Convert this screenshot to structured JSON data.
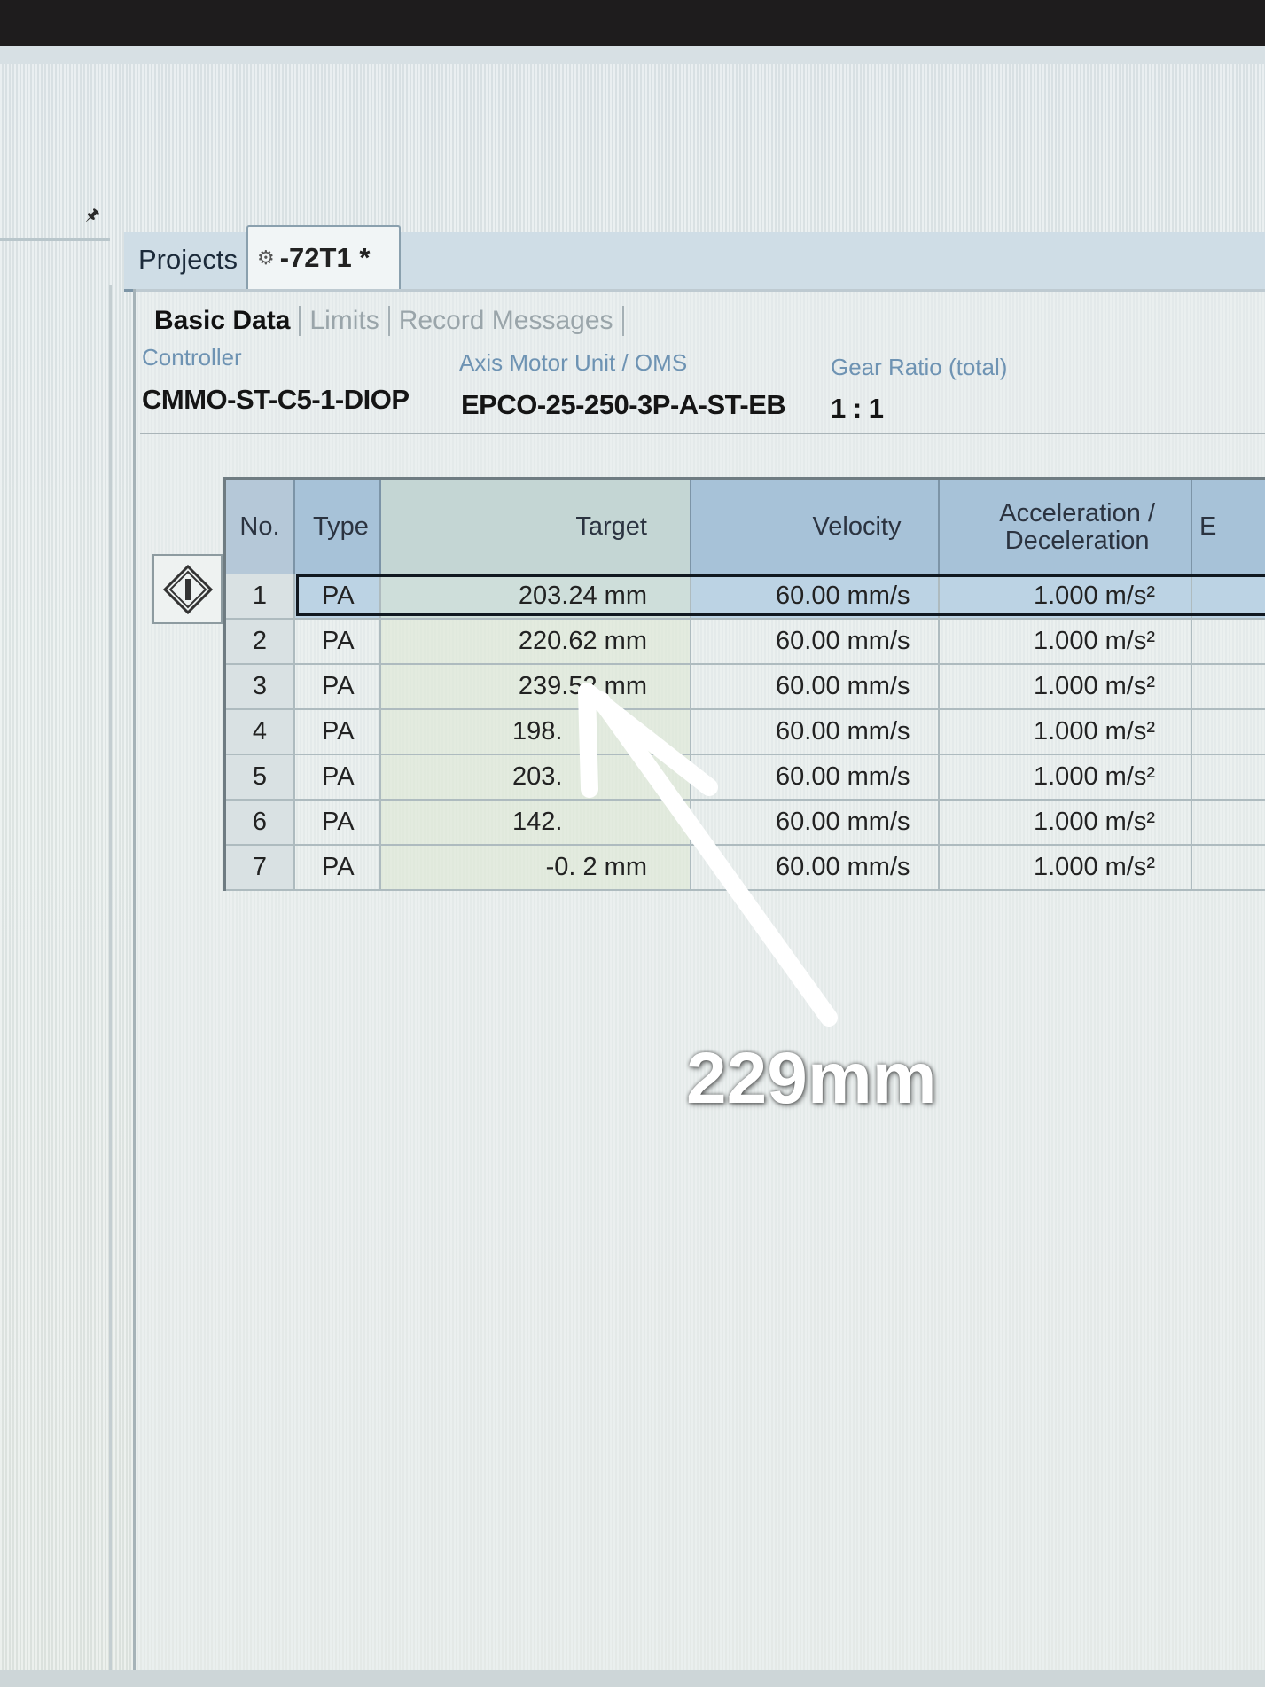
{
  "tabs": {
    "projects_label": "Projects",
    "device_label": "-72T1 *"
  },
  "subtabs": [
    "Basic Data",
    "Limits",
    "Record Messages"
  ],
  "info": {
    "controller_label": "Controller",
    "controller_value": "CMMO-ST-C5-1-DIOP",
    "axis_label": "Axis Motor Unit / OMS",
    "axis_value": "EPCO-25-250-3P-A-ST-EB",
    "gear_label": "Gear Ratio (total)",
    "gear_value": "1 : 1"
  },
  "table": {
    "headers": {
      "no": "No.",
      "type": "Type",
      "target": "Target",
      "velocity": "Velocity",
      "acc_line1": "Acceleration /",
      "acc_line2": "Deceleration",
      "extra": "E"
    },
    "rows": [
      {
        "no": "1",
        "type": "PA",
        "target": "203.24 mm",
        "velocity": "60.00 mm/s",
        "acc": "1.000 m/s²"
      },
      {
        "no": "2",
        "type": "PA",
        "target": "220.62 mm",
        "velocity": "60.00 mm/s",
        "acc": "1.000 m/s²"
      },
      {
        "no": "3",
        "type": "PA",
        "target": "239.52 mm",
        "velocity": "60.00 mm/s",
        "acc": "1.000 m/s²"
      },
      {
        "no": "4",
        "type": "PA",
        "target": "198.",
        "velocity": "60.00 mm/s",
        "acc": "1.000 m/s²"
      },
      {
        "no": "5",
        "type": "PA",
        "target": "203.",
        "velocity": "60.00 mm/s",
        "acc": "1.000 m/s²"
      },
      {
        "no": "6",
        "type": "PA",
        "target": "142.",
        "velocity": "60.00 mm/s",
        "acc": "1.000 m/s²"
      },
      {
        "no": "7",
        "type": "PA",
        "target": "-0. 2 mm",
        "velocity": "60.00 mm/s",
        "acc": "1.000 m/s²"
      }
    ]
  },
  "annotation": {
    "text": "229mm",
    "color": "#ffffff"
  },
  "icons": {
    "pin": "pin-icon",
    "device": "device-icon",
    "record_indicator": "diamond-record-icon"
  }
}
